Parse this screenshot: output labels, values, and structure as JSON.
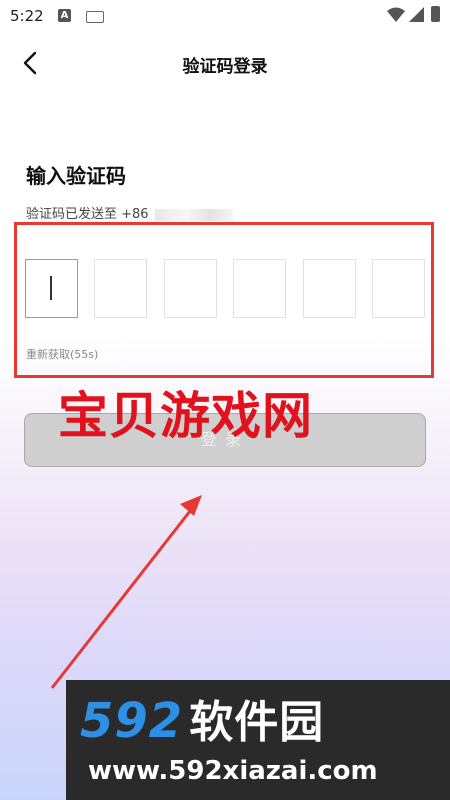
{
  "status_bar": {
    "time": "5:22",
    "badge": "A"
  },
  "nav": {
    "title": "验证码登录"
  },
  "heading": "输入验证码",
  "sent_to_prefix": "验证码已发送至 +86",
  "code_inputs": [
    "",
    "",
    "",
    "",
    "",
    ""
  ],
  "resend_text": "重新获取(55s)",
  "login_button": "登录",
  "watermark_text": "宝贝游戏网",
  "banner": {
    "brand": "592",
    "brand_cn": "软件园",
    "url": "www.592xiazai.com"
  },
  "colors": {
    "annotation_red": "#e53935",
    "watermark_red": "#e0121c",
    "brand_blue": "#2e8fe6",
    "button_gray": "#cfcfcf"
  }
}
